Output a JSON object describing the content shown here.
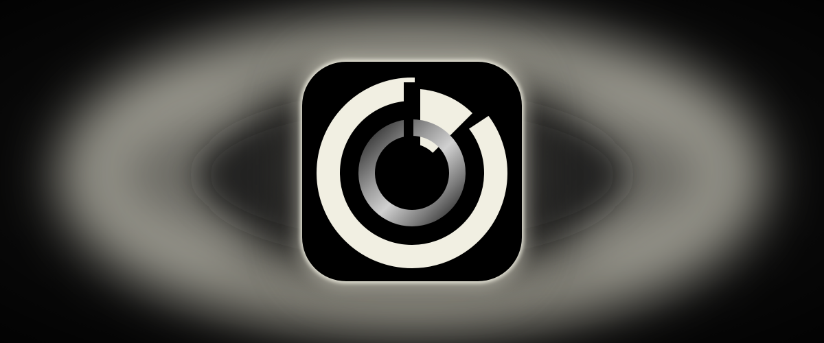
{
  "colors": {
    "background_base": "#050505",
    "background_glow": "#c9c7bb",
    "icon_background": "#000000",
    "icon_ring": "#f1efe2",
    "icon_inner_light": "#b8b8b8",
    "icon_inner_dark": "#1a1a1a",
    "icon_glow": "#f0eee1"
  },
  "icon": {
    "semantic_name": "timer-app-icon"
  }
}
